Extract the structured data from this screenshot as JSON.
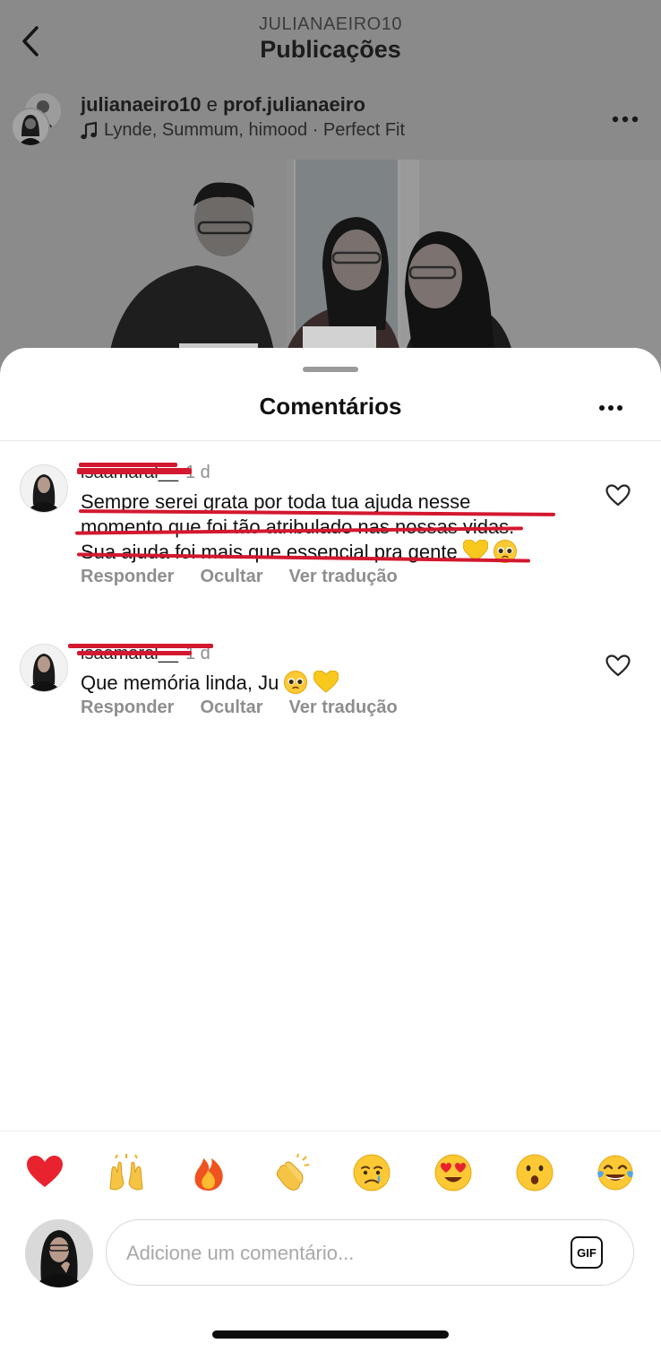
{
  "topbar": {
    "account": "JULIANAEIRO10",
    "title": "Publicações"
  },
  "post": {
    "user1": "julianaeiro10",
    "joiner": " e ",
    "user2": "prof.julianaeiro",
    "music": "Lynde, Summum, himood · Perfect Fit"
  },
  "sheet": {
    "title": "Comentários"
  },
  "comments": [
    {
      "username": "isaamaral__",
      "time": "1 d",
      "text_line1": "Sempre serei grata por toda tua ajuda nesse",
      "text_line2": "momento que foi tão atribulado nas nossas vidas.",
      "text_line3": "Sua ajuda foi mais que essencial pra gente",
      "reply": "Responder",
      "hide": "Ocultar",
      "translate": "Ver tradução"
    },
    {
      "username": "isaamaral__",
      "time": "1 d",
      "text": "Que memória linda, Ju",
      "reply": "Responder",
      "hide": "Ocultar",
      "translate": "Ver tradução"
    }
  ],
  "reactions": [
    "red-heart",
    "raising-hands",
    "fire",
    "clapping-hands",
    "crying-face",
    "heart-eyes-face",
    "surprised-face",
    "tears-of-joy-face"
  ],
  "composer": {
    "placeholder": "Adicione um comentário...",
    "gif_label": "GIF"
  },
  "colors": {
    "redline": "#d3182f",
    "secondary_text": "#8e8e8e",
    "dim_overlay": "#8a8a8a"
  }
}
